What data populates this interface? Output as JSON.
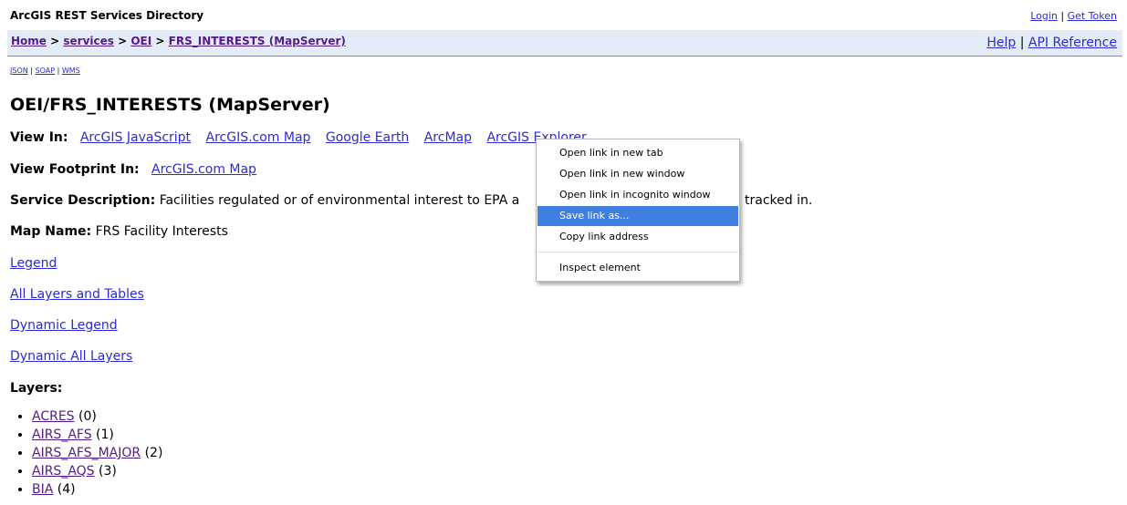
{
  "header": {
    "app_title": "ArcGIS REST Services Directory",
    "login_label": "Login",
    "separator": "|",
    "get_token_label": "Get Token"
  },
  "breadcrumb": {
    "home": "Home",
    "services": "services",
    "folder": "OEI",
    "current": "FRS_INTERESTS (MapServer)",
    "sep": ">"
  },
  "help_links": {
    "help": "Help",
    "sep": "|",
    "api_reference": "API Reference"
  },
  "formats": {
    "json": "JSON",
    "soap": "SOAP",
    "wms": "WMS",
    "sep": "|"
  },
  "page_title": "OEI/FRS_INTERESTS (MapServer)",
  "view_in": {
    "label": "View In:",
    "links": [
      "ArcGIS JavaScript",
      "ArcGIS.com Map",
      "Google Earth",
      "ArcMap",
      "ArcGIS Explorer"
    ]
  },
  "view_footprint": {
    "label": "View Footprint In:",
    "link": "ArcGIS.com Map"
  },
  "service_description": {
    "label": "Service Description:",
    "text_start": "Facilities regulated or of environmental interest to EPA a",
    "text_end": "tracked in."
  },
  "map_name": {
    "label": "Map Name:",
    "value": "FRS Facility Interests"
  },
  "links": {
    "legend": "Legend",
    "all_layers": "All Layers and Tables",
    "dynamic_legend": "Dynamic Legend",
    "dynamic_all_layers": "Dynamic All Layers"
  },
  "layers": {
    "heading": "Layers:",
    "items": [
      {
        "name": "ACRES",
        "id": "(0)"
      },
      {
        "name": "AIRS_AFS",
        "id": "(1)"
      },
      {
        "name": "AIRS_AFS_MAJOR",
        "id": "(2)"
      },
      {
        "name": "AIRS_AQS",
        "id": "(3)"
      },
      {
        "name": "BIA",
        "id": "(4)"
      }
    ]
  },
  "context_menu": {
    "items": [
      "Open link in new tab",
      "Open link in new window",
      "Open link in incognito window",
      "Save link as...",
      "Copy link address",
      "Inspect element"
    ],
    "highlighted": "Save link as..."
  }
}
